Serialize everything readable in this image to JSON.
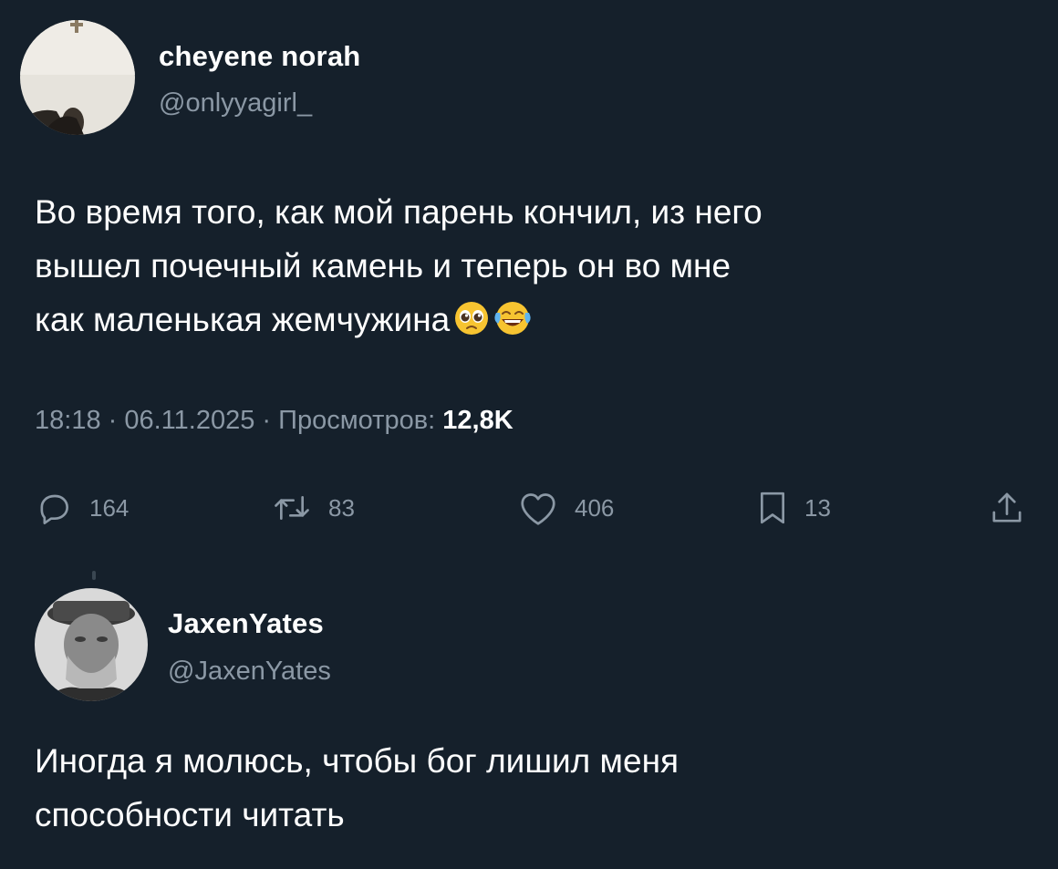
{
  "tweet": {
    "author_name": "cheyene norah",
    "author_handle": "@onlyyagirl_",
    "text_lines": [
      "Во время того, как мой парень кончил, из него",
      "вышел почечный камень и теперь он во мне",
      "как маленькая жемчужина"
    ],
    "emojis": [
      "pleading-face-emoji",
      "tears-of-joy-emoji"
    ],
    "time": "18:18",
    "date": "06.11.2025",
    "views_label": "Просмотров:",
    "views_count": "12,8K",
    "actions": {
      "replies": "164",
      "retweets": "83",
      "likes": "406",
      "bookmarks": "13"
    }
  },
  "reply": {
    "author_name": "JaxenYates",
    "author_handle": "@JaxenYates",
    "text_lines": [
      "Иногда я молюсь, чтобы бог лишил меня",
      "способности читать"
    ]
  },
  "colors": {
    "background": "#15202b",
    "text_primary": "#ffffff",
    "text_secondary": "#8b98a5"
  }
}
